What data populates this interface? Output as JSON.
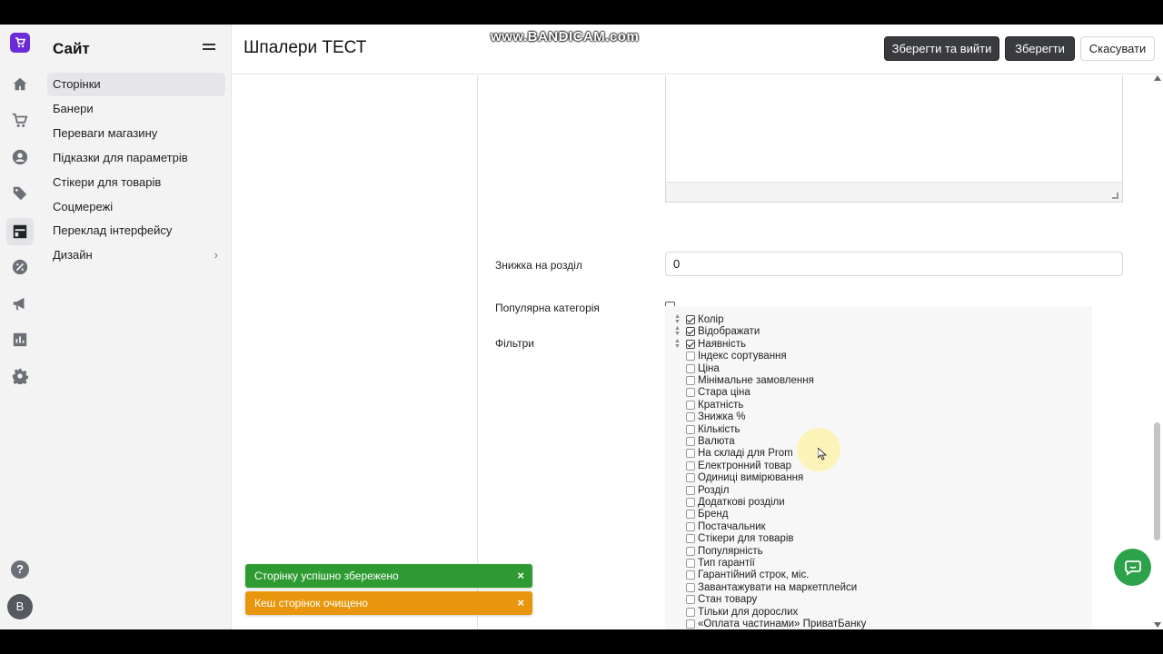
{
  "watermark": "www.BANDICAM.com",
  "rail": {
    "logo_icon": "cart-logo-icon",
    "icons": [
      "home-icon",
      "cart-icon",
      "user-icon",
      "tag-icon",
      "layout-icon",
      "discount-icon",
      "megaphone-icon",
      "chart-icon",
      "gear-icon"
    ],
    "active_icon": "layout-icon",
    "help_label": "?",
    "avatar_label": "B"
  },
  "sidebar": {
    "title": "Сайт",
    "items": [
      {
        "label": "Сторінки",
        "active": true
      },
      {
        "label": "Банери"
      },
      {
        "label": "Переваги магазину"
      },
      {
        "label": "Підказки для параметрів"
      },
      {
        "label": "Стікери для товарів"
      },
      {
        "label": "Соцмережі"
      },
      {
        "label": "Переклад інтерфейсу"
      },
      {
        "label": "Дизайн",
        "chevron": "›"
      }
    ]
  },
  "header": {
    "title": "Шпалери ТЕСТ",
    "save_exit_label": "Зберегти та вийти",
    "save_label": "Зберегти",
    "cancel_label": "Скасувати"
  },
  "form": {
    "discount_label": "Знижка на розділ",
    "discount_value": "0",
    "popular_label": "Популярна категорія",
    "popular_checked": false,
    "filters_label": "Фільтри",
    "filters": [
      {
        "label": "Колір",
        "checked": true
      },
      {
        "label": "Відображати",
        "checked": true
      },
      {
        "label": "Наявність",
        "checked": true
      },
      {
        "label": "Індекс сортування",
        "checked": false
      },
      {
        "label": "Ціна",
        "checked": false
      },
      {
        "label": "Мінімальне замовлення",
        "checked": false
      },
      {
        "label": "Стара ціна",
        "checked": false
      },
      {
        "label": "Кратність",
        "checked": false
      },
      {
        "label": "Знижка %",
        "checked": false
      },
      {
        "label": "Кількість",
        "checked": false
      },
      {
        "label": "Валюта",
        "checked": false
      },
      {
        "label": "На складі для Prom",
        "checked": false
      },
      {
        "label": "Електронний товар",
        "checked": false
      },
      {
        "label": "Одиниці вимірювання",
        "checked": false
      },
      {
        "label": "Розділ",
        "checked": false
      },
      {
        "label": "Додаткові розділи",
        "checked": false
      },
      {
        "label": "Бренд",
        "checked": false
      },
      {
        "label": "Постачальник",
        "checked": false
      },
      {
        "label": "Стікери для товарів",
        "checked": false
      },
      {
        "label": "Популярність",
        "checked": false
      },
      {
        "label": "Тип гарантії",
        "checked": false
      },
      {
        "label": "Гарантійний строк, міс.",
        "checked": false
      },
      {
        "label": "Завантажувати на маркетплейси",
        "checked": false
      },
      {
        "label": "Стан товару",
        "checked": false
      },
      {
        "label": "Тільки для дорослих",
        "checked": false
      },
      {
        "label": "«Оплата частинами» ПриватБанку",
        "checked": false
      }
    ]
  },
  "toasts": [
    {
      "text": "Сторінку успішно збережено",
      "color": "#2e9b32",
      "close": "×"
    },
    {
      "text": "Кеш сторінок очищено",
      "color": "#e8970c",
      "close": "×"
    }
  ],
  "chat_icon": "chat-icon"
}
